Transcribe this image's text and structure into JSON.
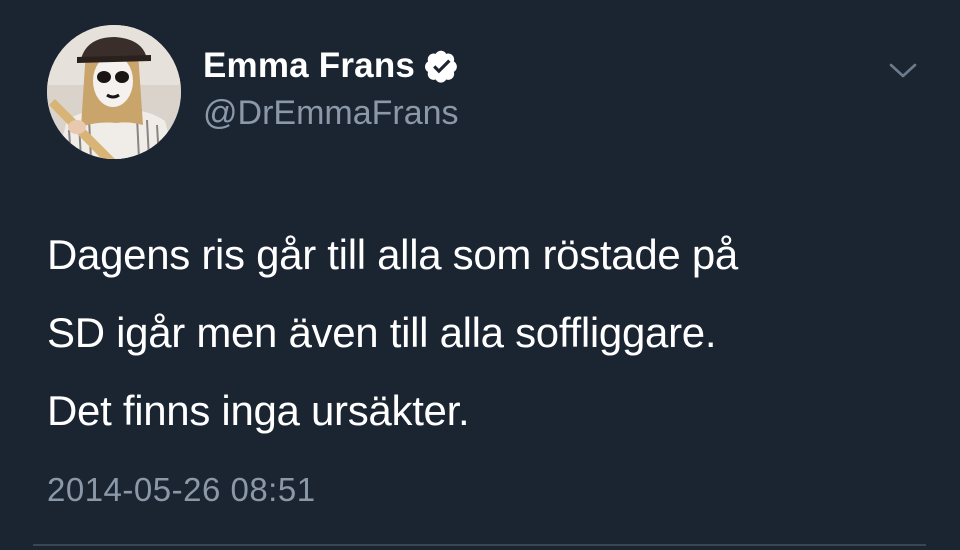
{
  "tweet": {
    "author": {
      "display_name": "Emma Frans",
      "handle": "@DrEmmaFrans",
      "verified": true,
      "avatar_icon": "user-avatar-photo"
    },
    "text_lines": [
      "Dagens ris går till alla som röstade på",
      "SD igår men även till alla soffliggare.",
      "Det finns inga ursäkter."
    ],
    "timestamp": "2014-05-26 08:51",
    "menu_icon": "chevron-down-icon"
  },
  "theme": {
    "background": "#1b2532",
    "text_primary": "#ffffff",
    "text_secondary": "#8a98a8",
    "divider": "#3a4654"
  }
}
